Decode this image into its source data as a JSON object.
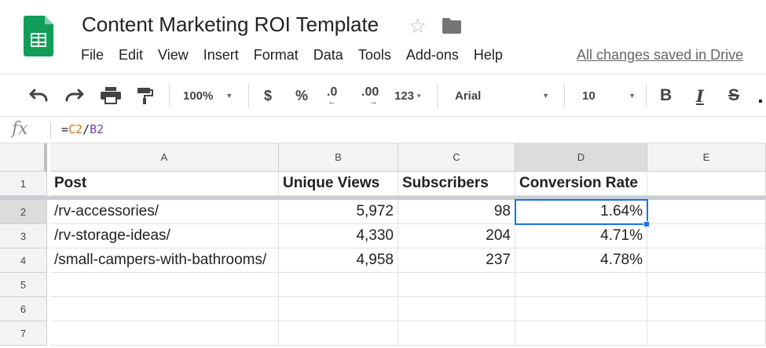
{
  "app": {
    "doc_title": "Content Marketing ROI Template",
    "menu": [
      "File",
      "Edit",
      "View",
      "Insert",
      "Format",
      "Data",
      "Tools",
      "Add-ons",
      "Help"
    ],
    "save_status": "All changes saved in Drive",
    "brand_color": "#0f9d58"
  },
  "toolbar": {
    "zoom": "100%",
    "currency": "$",
    "percent": "%",
    "decrease_decimal": ".0",
    "increase_decimal": ".00",
    "more_formats": "123",
    "font": "Arial",
    "font_size": "10",
    "bold": "B",
    "italic": "I",
    "strikethrough": "S"
  },
  "formula_bar": {
    "fx": "fx",
    "formula_prefix": "=",
    "ref1": "C2",
    "operator": "/",
    "ref2": "B2"
  },
  "grid": {
    "columns": [
      "A",
      "B",
      "C",
      "D",
      "E"
    ],
    "rows": [
      "1",
      "2",
      "3",
      "4",
      "5",
      "6",
      "7"
    ],
    "header_row": [
      "Post",
      "Unique Views",
      "Subscribers",
      "Conversion Rate",
      ""
    ],
    "data": [
      [
        "/rv-accessories/",
        "5,972",
        "98",
        "1.64%",
        ""
      ],
      [
        "/rv-storage-ideas/",
        "4,330",
        "204",
        "4.71%",
        ""
      ],
      [
        "/small-campers-with-bathrooms/",
        "4,958",
        "237",
        "4.78%",
        ""
      ]
    ],
    "selected_cell": "D2"
  }
}
